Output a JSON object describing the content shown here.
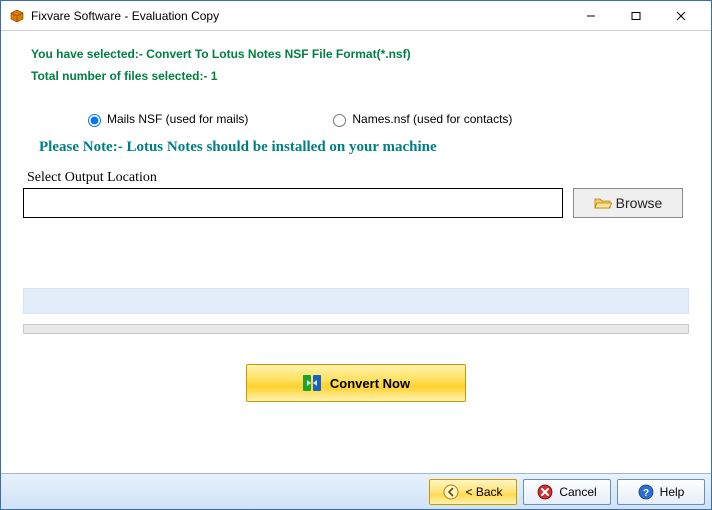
{
  "title": "Fixvare Software - Evaluation Copy",
  "header": {
    "selected_line": "You have selected:- Convert To Lotus Notes NSF File Format(*.nsf)",
    "count_line": "Total number of files selected:- 1"
  },
  "radios": {
    "mails": {
      "label": "Mails NSF (used for mails)",
      "checked": true
    },
    "names": {
      "label": "Names.nsf (used for contacts)",
      "checked": false
    }
  },
  "note": "Please Note:- Lotus Notes should be installed on your machine",
  "output": {
    "label": "Select Output Location",
    "value": "",
    "browse": "Browse"
  },
  "convert_label": "Convert Now",
  "footer": {
    "back": "< Back",
    "cancel": "Cancel",
    "help": "Help"
  }
}
